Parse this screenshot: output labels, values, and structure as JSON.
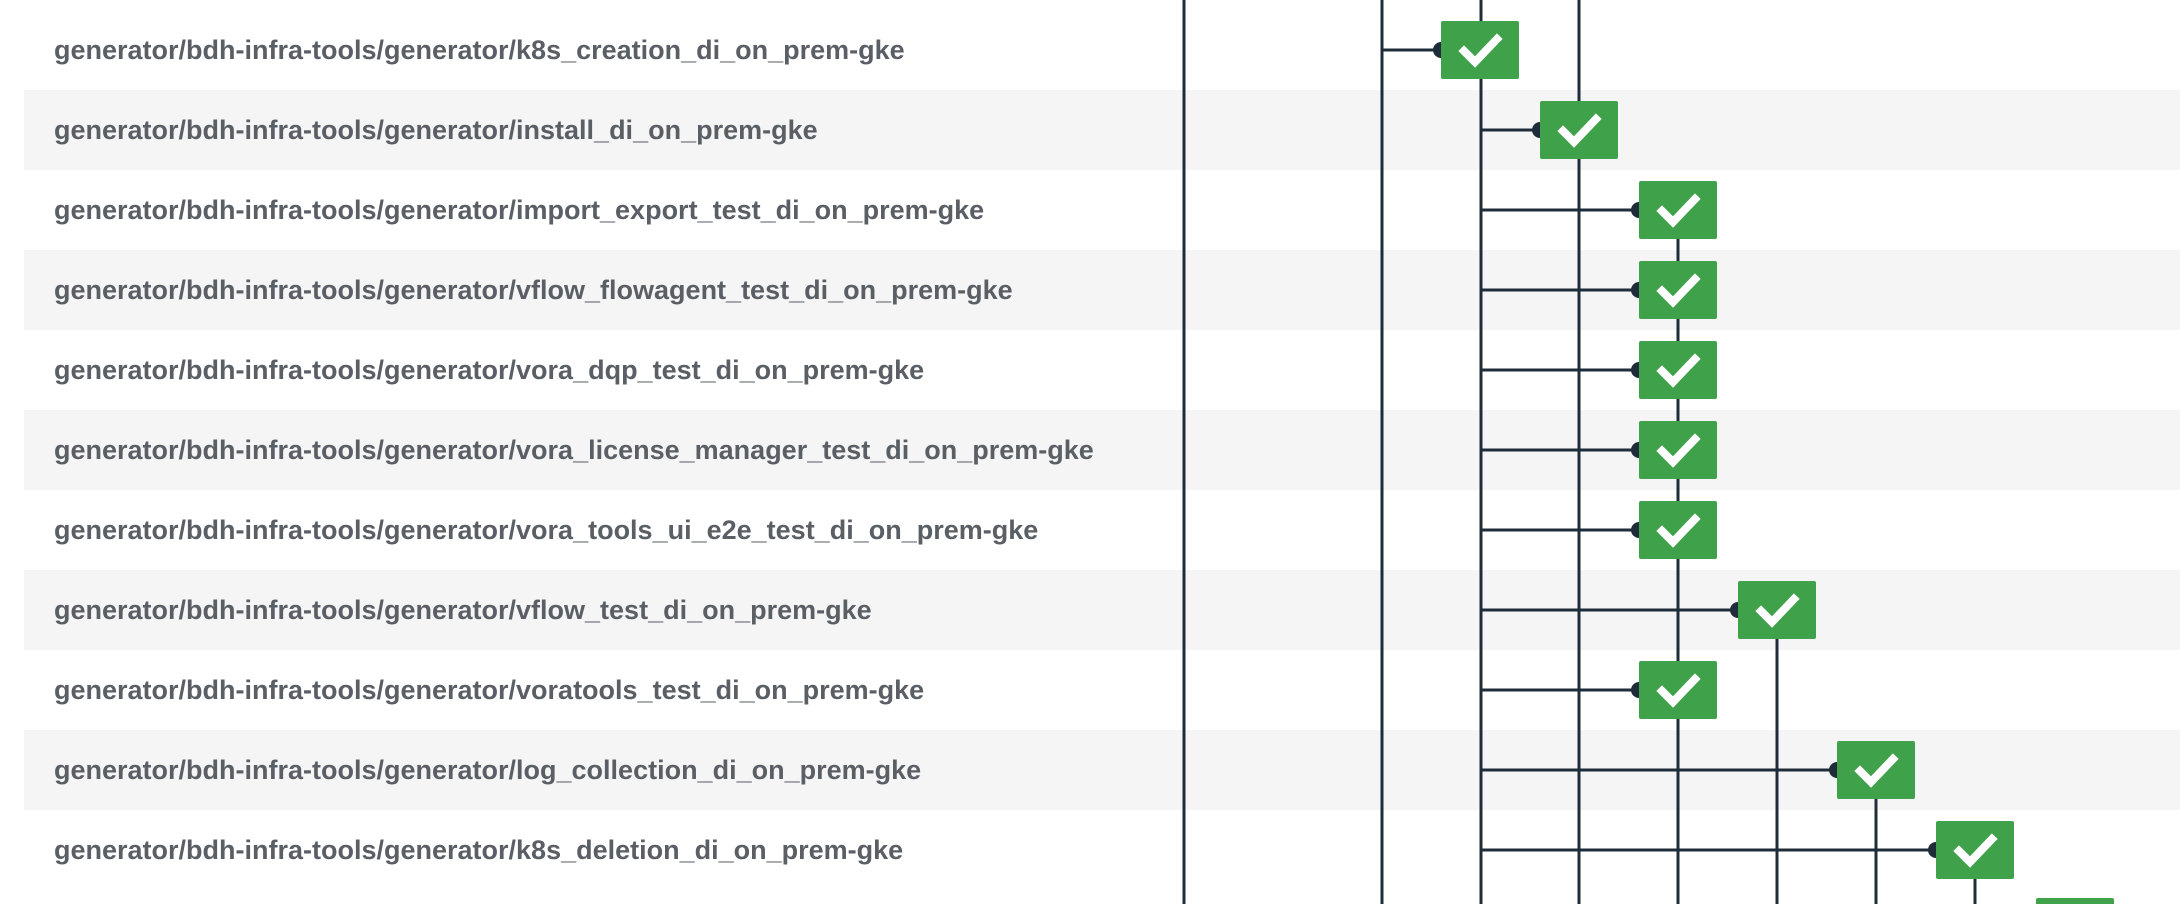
{
  "colors": {
    "success": "#3fa24a",
    "line": "#1f2d3a",
    "row_alt": "#f5f5f5",
    "label": "#5a5f66"
  },
  "jobs": [
    {
      "name": "generator/bdh-infra-tools/generator/k8s_creation_di_on_prem-gke",
      "status": "success",
      "icon": "check-icon"
    },
    {
      "name": "generator/bdh-infra-tools/generator/install_di_on_prem-gke",
      "status": "success",
      "icon": "check-icon"
    },
    {
      "name": "generator/bdh-infra-tools/generator/import_export_test_di_on_prem-gke",
      "status": "success",
      "icon": "check-icon"
    },
    {
      "name": "generator/bdh-infra-tools/generator/vflow_flowagent_test_di_on_prem-gke",
      "status": "success",
      "icon": "check-icon"
    },
    {
      "name": "generator/bdh-infra-tools/generator/vora_dqp_test_di_on_prem-gke",
      "status": "success",
      "icon": "check-icon"
    },
    {
      "name": "generator/bdh-infra-tools/generator/vora_license_manager_test_di_on_prem-gke",
      "status": "success",
      "icon": "check-icon"
    },
    {
      "name": "generator/bdh-infra-tools/generator/vora_tools_ui_e2e_test_di_on_prem-gke",
      "status": "success",
      "icon": "check-icon"
    },
    {
      "name": "generator/bdh-infra-tools/generator/vflow_test_di_on_prem-gke",
      "status": "success",
      "icon": "check-icon"
    },
    {
      "name": "generator/bdh-infra-tools/generator/voratools_test_di_on_prem-gke",
      "status": "success",
      "icon": "check-icon"
    },
    {
      "name": "generator/bdh-infra-tools/generator/log_collection_di_on_prem-gke",
      "status": "success",
      "icon": "check-icon"
    },
    {
      "name": "generator/bdh-infra-tools/generator/k8s_deletion_di_on_prem-gke",
      "status": "success",
      "icon": "check-icon"
    }
  ]
}
